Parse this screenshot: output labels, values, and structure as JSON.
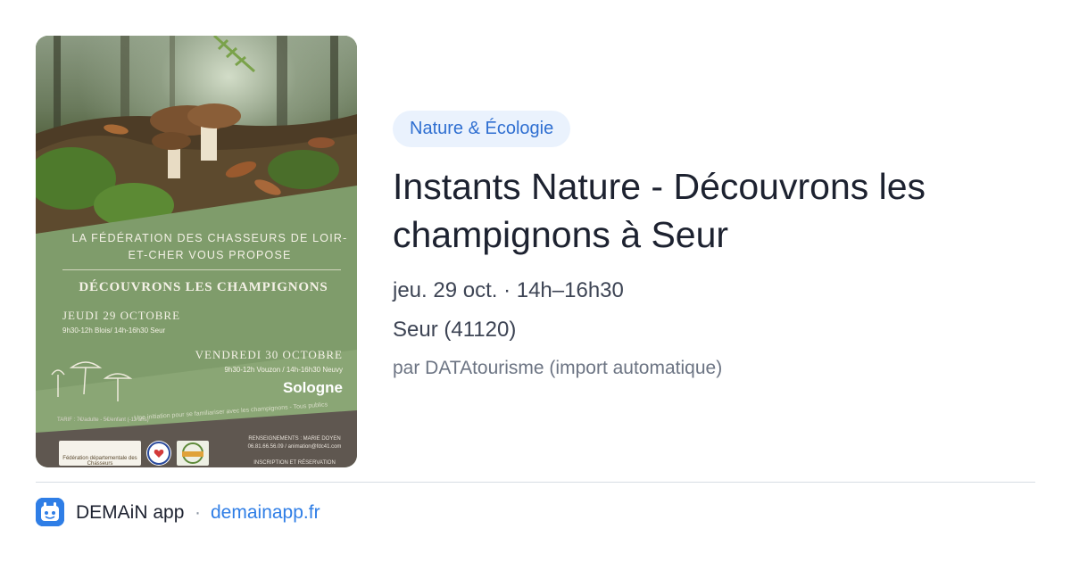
{
  "poster": {
    "federation_line": "LA FÉDÉRATION DES CHASSEURS DE LOIR-ET-CHER VOUS PROPOSE",
    "headline": "DÉCOUVRONS LES CHAMPIGNONS",
    "date1": "JEUDI 29 OCTOBRE",
    "date1_times": "9h30-12h Blois/ 14h-16h30 Seur",
    "date2": "VENDREDI 30 OCTOBRE",
    "date2_times": "9h30-12h Vouzon / 14h-16h30 Neuvy",
    "partner": "Sologne",
    "banner": "Une initiation pour se familiariser avec les champignons - Tous publics",
    "tarif": "TARIF : 7€/adulte - 5€/enfant (-12 ans)",
    "logo1_text": "Fédération départementale des Chasseurs",
    "contact": "RENSEIGNEMENTS : MARIE DOYEN\n06.81.66.56.09 / animation@fdc41.com\n\nINSCRIPTION ET RÉSERVATION"
  },
  "event": {
    "category": "Nature & Écologie",
    "title": "Instants Nature - Découvrons les champignons à Seur",
    "date": "jeu. 29 oct. · 14h–16h30",
    "location": "Seur (41120)",
    "source": "par DATAtourisme (import automatique)"
  },
  "footer": {
    "app_name": "DEMAiN app",
    "separator": "·",
    "link": "demainapp.fr",
    "app_icon": "app-logo-icon"
  },
  "colors": {
    "accent": "#2f7ee6",
    "category_bg": "#eaf2fd",
    "category_text": "#2f6fd1",
    "poster_green": "#7d9a69"
  }
}
